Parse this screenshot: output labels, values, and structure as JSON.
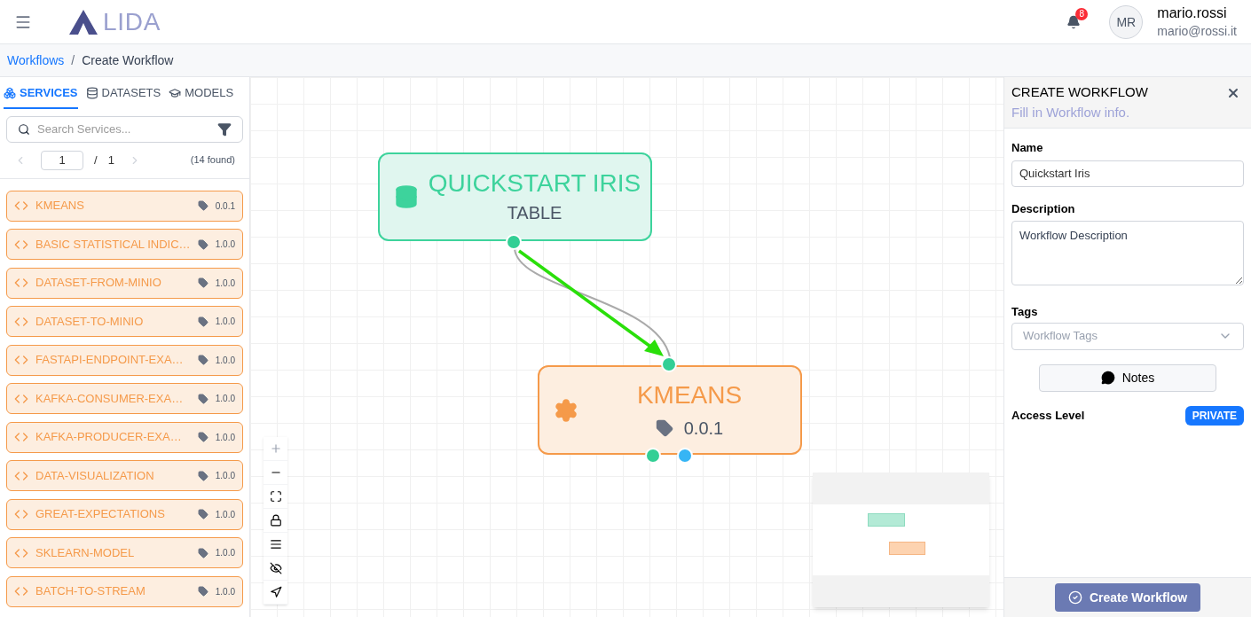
{
  "header": {
    "logo": "LIDA",
    "notifications": "8",
    "user": {
      "initials": "MR",
      "name": "mario.rossi",
      "email": "mario@rossi.it"
    }
  },
  "breadcrumb": {
    "items": [
      "Workflows",
      "Create Workflow"
    ],
    "separator": "/"
  },
  "sidebar": {
    "tabs": [
      {
        "label": "SERVICES",
        "selected": true,
        "kind": "services"
      },
      {
        "label": "DATASETS",
        "selected": false,
        "kind": "datasets"
      },
      {
        "label": "MODELS",
        "selected": false,
        "kind": "models"
      }
    ],
    "search": {
      "placeholder": "Search Services..."
    },
    "pager": {
      "page": "1",
      "separator": "/",
      "total": "1",
      "found": "(14 found)"
    },
    "services": [
      {
        "name": "KMEANS",
        "version": "0.0.1"
      },
      {
        "name": "BASIC STATISTICAL INDIC…",
        "version": "1.0.0"
      },
      {
        "name": "DATASET-FROM-MINIO",
        "version": "1.0.0"
      },
      {
        "name": "DATASET-TO-MINIO",
        "version": "1.0.0"
      },
      {
        "name": "FASTAPI-ENDPOINT-EXA…",
        "version": "1.0.0"
      },
      {
        "name": "KAFKA-CONSUMER-EXA…",
        "version": "1.0.0"
      },
      {
        "name": "KAFKA-PRODUCER-EXA…",
        "version": "1.0.0"
      },
      {
        "name": "DATA-VISUALIZATION",
        "version": "1.0.0"
      },
      {
        "name": "GREAT-EXPECTATIONS",
        "version": "1.0.0"
      },
      {
        "name": "SKLEARN-MODEL",
        "version": "1.0.0"
      },
      {
        "name": "BATCH-TO-STREAM",
        "version": "1.0.0"
      }
    ]
  },
  "canvas": {
    "nodes": [
      {
        "kind": "dataset",
        "title": "QUICKSTART IRIS",
        "subtitle": "TABLE"
      },
      {
        "kind": "service",
        "title": "KMEANS",
        "subtitle": "0.0.1"
      }
    ]
  },
  "panel": {
    "title": "CREATE WORKFLOW",
    "subtitle": "Fill in Workflow info.",
    "name": {
      "label": "Name",
      "value": "Quickstart Iris"
    },
    "description": {
      "label": "Description",
      "value": "Workflow Description"
    },
    "tags": {
      "label": "Tags",
      "placeholder": "Workflow Tags"
    },
    "notes_button": "Notes",
    "access": {
      "label": "Access Level",
      "value": "PRIVATE"
    },
    "submit": "Create Workflow"
  }
}
